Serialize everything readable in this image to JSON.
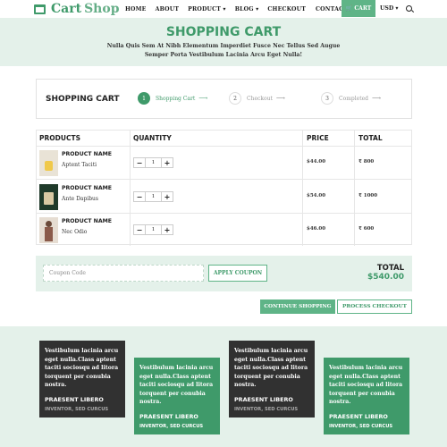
{
  "brand": {
    "word1": "Cart",
    "word2": "Shop"
  },
  "nav": {
    "items": [
      "HOME",
      "ABOUT",
      "PRODUCT ▾",
      "BLOG ▾",
      "CHECKOUT",
      "CONTACT"
    ],
    "cart_label": "🛒 CART",
    "currency": "USD ▾"
  },
  "hero": {
    "title": "SHOPPING CART",
    "line1": "Nulla Quis Sem At Nibh Elementum Imperdiet Fusce Nec Tellus Sed Augue",
    "line2": "Semper Porta Vestibulum Lacinia Arcu Eget Nulla!"
  },
  "steps": {
    "title": "SHOPPING CART",
    "items": [
      {
        "num": "1",
        "label": "Shopping Cart"
      },
      {
        "num": "2",
        "label": "Checkout"
      },
      {
        "num": "3",
        "label": "Completed"
      }
    ],
    "arrow": "⟶"
  },
  "table": {
    "headers": [
      "PRODUCTS",
      "QUANTITY",
      "PRICE",
      "TOTAL"
    ],
    "rows": [
      {
        "name": "PRODUCT NAME",
        "variant": "Aptent Taciti",
        "qty": "1",
        "price": "$44.00",
        "total": "₹ 800"
      },
      {
        "name": "PRODUCT NAME",
        "variant": "Ante Dapibus",
        "qty": "1",
        "price": "$54.00",
        "total": "₹ 1000"
      },
      {
        "name": "PRODUCT NAME",
        "variant": "Nec Odio",
        "qty": "1",
        "price": "$46.00",
        "total": "₹ 600"
      }
    ],
    "minus": "−",
    "plus": "+"
  },
  "coupon": {
    "placeholder": "Coupon Code",
    "apply": "APPLY COUPON",
    "total_label": "TOTAL",
    "total_value": "$540.00"
  },
  "actions": {
    "continue": "CONTINUE SHOPPING",
    "checkout": "PROCESS CHECKOUT"
  },
  "testimonials": [
    {
      "quote": "Vestibulum lacinia arcu eget nulla.Class aptent taciti sociosqu ad litora torquent per conubia nostra.",
      "name": "PRAESENT LIBERO",
      "role": "INVENTOR, SED CURCUS"
    },
    {
      "quote": "Vestibulum lacinia arcu eget nulla.Class aptent taciti sociosqu ad litora torquent per conubia nostra.",
      "name": "PRAESENT LIBERO",
      "role": "INVENTOR, SED CURCUS"
    },
    {
      "quote": "Vestibulum lacinia arcu eget nulla.Class aptent taciti sociosqu ad litora torquent per conubia nostra.",
      "name": "PRAESENT LIBERO",
      "role": "INVENTOR, SED CURCUS"
    },
    {
      "quote": "Vestibulum lacinia arcu eget nulla.Class aptent taciti sociosqu ad litora torquent per conubia nostra.",
      "name": "PRAESENT LIBERO",
      "role": "INVENTOR, SED CURCUS"
    }
  ],
  "colors": {
    "accent": "#3f9a6a",
    "accent_light": "#5fb487",
    "tint": "#e4f1ea",
    "dark": "#313131"
  }
}
